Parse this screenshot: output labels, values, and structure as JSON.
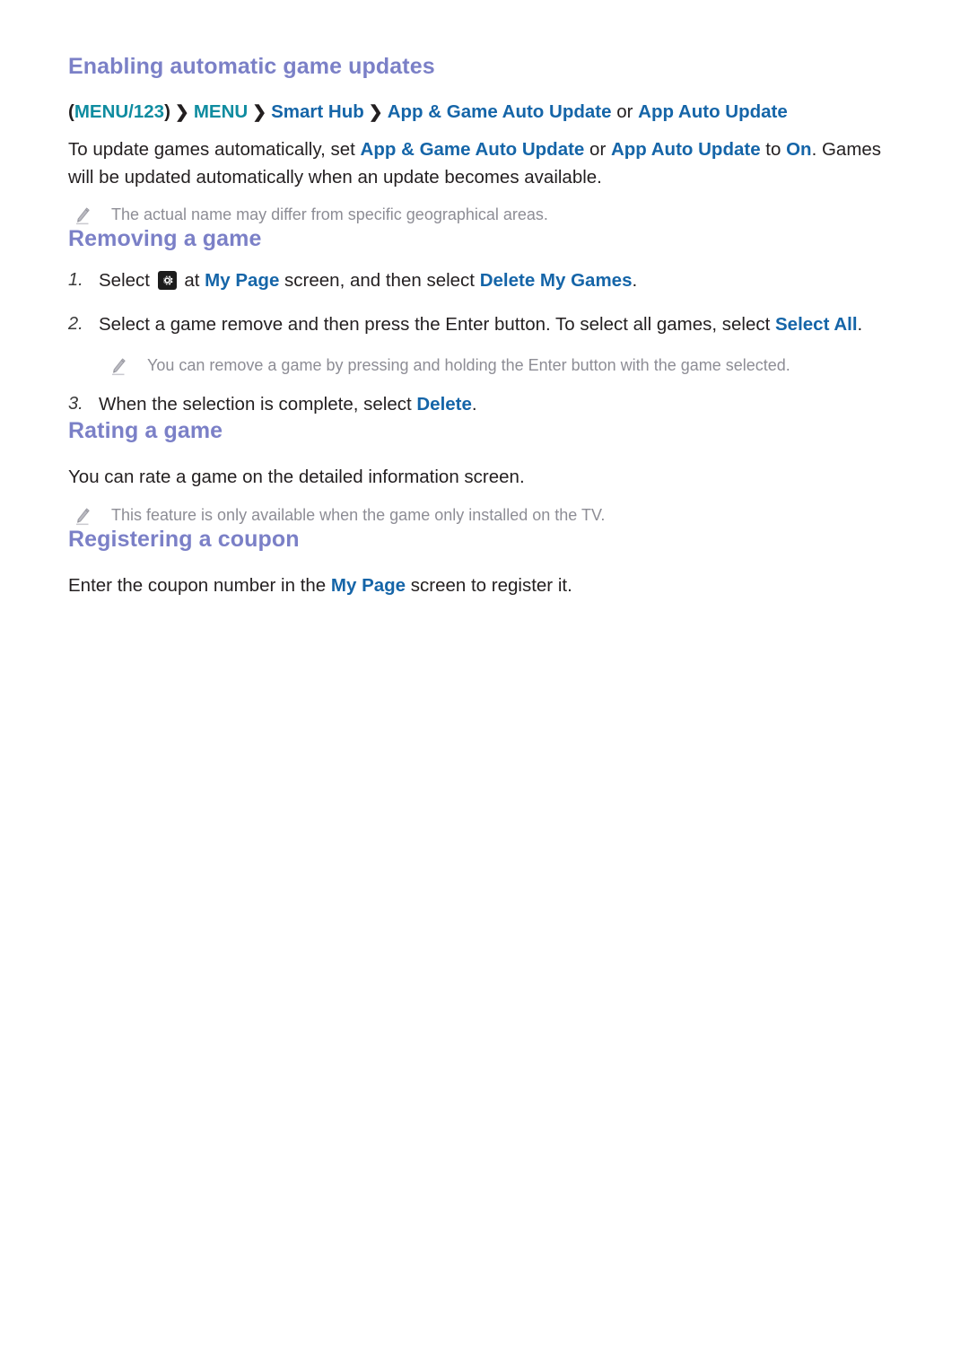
{
  "document": {
    "type": "e-manual-page",
    "background_color": "#ffffff"
  },
  "colors": {
    "heading": "#7b80c7",
    "keyword_blue": "#1565a8",
    "path_teal": "#0f8ca0",
    "body_text": "#231f20",
    "note_text": "#8d8d95",
    "gear_badge_bg": "#1c1c1c"
  },
  "sections": {
    "enabling": {
      "heading": "Enabling automatic game updates",
      "path": {
        "open_paren": "(",
        "menu123": "MENU/123",
        "close_paren": ")",
        "sep": "❯",
        "menu": "MENU",
        "smart_hub": "Smart Hub",
        "app_game_auto_update": "App & Game Auto Update",
        "or": " or ",
        "app_auto_update": "App Auto Update"
      },
      "paragraph": {
        "part1": "To update games automatically, set ",
        "kw1": "App & Game Auto Update",
        "part2": " or ",
        "kw2": "App Auto Update",
        "part3": " to ",
        "kw3": "On",
        "part4": ". Games will be updated automatically when an update becomes available."
      },
      "note": "The actual name may differ from specific geographical areas."
    },
    "removing": {
      "heading": "Removing a game",
      "steps": [
        {
          "number": "1.",
          "text_part1": "Select ",
          "icon": "gear-icon",
          "text_part2": " at ",
          "kw1": "My Page",
          "text_part3": " screen, and then select ",
          "kw2": "Delete My Games",
          "text_part4": "."
        },
        {
          "number": "2.",
          "text_part1": "Select a game remove and then press the Enter button. To select all games, select ",
          "kw1": "Select All",
          "text_part2": "."
        },
        {
          "number": "3.",
          "text_part1": "When the selection is complete, select ",
          "kw1": "Delete",
          "text_part2": "."
        }
      ],
      "note": "You can remove a game by pressing and holding the Enter button with the game selected."
    },
    "rating": {
      "heading": "Rating a game",
      "paragraph": "You can rate a game on the detailed information screen.",
      "note": "This feature is only available when the game only installed on the TV."
    },
    "coupon": {
      "heading": "Registering a coupon",
      "paragraph": {
        "part1": "Enter the coupon number in the ",
        "kw1": "My Page",
        "part2": " screen to register it."
      }
    }
  }
}
